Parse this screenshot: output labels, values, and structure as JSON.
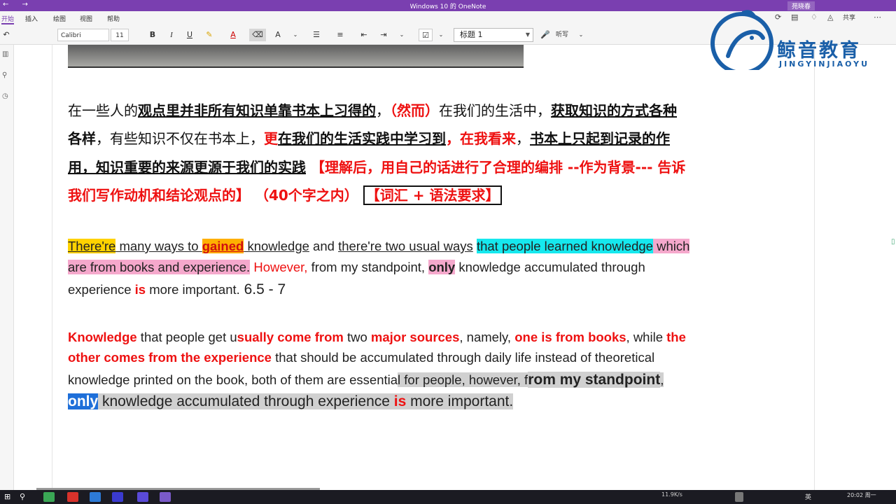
{
  "window": {
    "title": "Windows 10 的 OneNote",
    "user": "苑晓春"
  },
  "tabs": [
    "开始",
    "插入",
    "绘图",
    "视图",
    "帮助"
  ],
  "ribbon": {
    "font_name": "Calibri",
    "font_size": "11",
    "bold": "B",
    "italic": "I",
    "underline": "U",
    "style_value": "标题 1",
    "dictate": "听写",
    "share": "共享"
  },
  "logo": {
    "brand": "鲸音教育",
    "brand_en": "JINGYINJIAOYU"
  },
  "chinese_para": {
    "line1": [
      "在一些人的",
      "观点里并非所有知识单靠书本上习得的",
      "，",
      "（然而）",
      "在我们的生活中，",
      "获取知识的方式各种"
    ],
    "line2": [
      "各样",
      "，有些知识不仅在书本上，",
      "更",
      "在我们的生活实践中学习到",
      "，",
      "在我看来",
      "，",
      "书本上只起到记录的作"
    ],
    "line3": [
      "用，知识重要的来源更源于我们的实践",
      " 【理解后，用自己的话进行了合理的编排 --作为背景--- 告诉"
    ],
    "line4": [
      "我们写作动机和结论观点的】",
      "   （40个字之内）   ",
      "【词汇 + 语法要求】"
    ]
  },
  "english_para1": {
    "line1": [
      "There're",
      " many ways to ",
      "gained",
      " knowledge",
      " and ",
      "there're two usual ways",
      " ",
      "that people learned knowledge",
      " which"
    ],
    "line2": [
      "are from books and experience.",
      " However,",
      " from my standpoint, ",
      "only",
      " knowledge accumulated through"
    ],
    "line3": [
      "experience ",
      "is",
      " more important.",
      "    6.5 - 7"
    ]
  },
  "english_para2": {
    "line1": [
      "Knowledge",
      " that people get u",
      "sually come from",
      " two ",
      "major sources",
      ", namely, ",
      "one is from books",
      ", while ",
      "the"
    ],
    "line2": [
      "other comes from the experience",
      " that should be accumulated through daily life instead of theoretical"
    ],
    "line3": [
      "knowledge printed on the book, both of them are essentia",
      "l for people, however,  f",
      "rom my standpoint",
      ","
    ],
    "line4": [
      "only",
      " knowledge accumulated through experience ",
      "is",
      " more important."
    ]
  },
  "taskbar": {
    "net_speed": "11.9K/s",
    "time": "20:02 周一",
    "ime": "英"
  },
  "colors": {
    "title_bar": "#7a3fb0",
    "brand_blue": "#1a5fa8",
    "accent_red": "#ee1111"
  }
}
